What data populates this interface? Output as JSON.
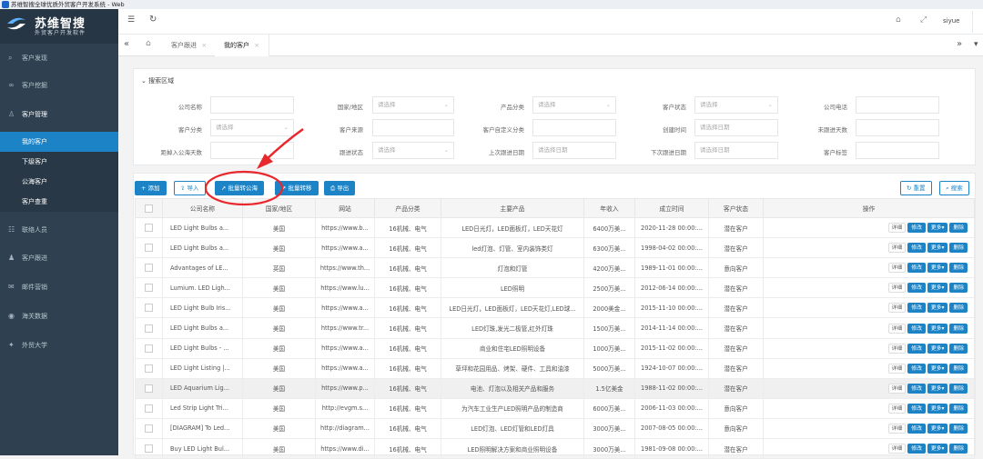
{
  "window": {
    "title": "苏维智搜全球优质外贸客户开发系统 - Web"
  },
  "logo": {
    "name": "苏维智搜",
    "slogan": "外贸客户开发软件"
  },
  "sidebar": {
    "items": [
      {
        "label": "客户发现",
        "icon": "search-icon"
      },
      {
        "label": "客户挖掘",
        "icon": "link-icon"
      },
      {
        "label": "客户管理",
        "icon": "user-icon"
      },
      {
        "label": "联络人员",
        "icon": "contacts-icon"
      },
      {
        "label": "客户跟进",
        "icon": "followup-icon"
      },
      {
        "label": "邮件营销",
        "icon": "mail-icon"
      },
      {
        "label": "海关数据",
        "icon": "globe-icon"
      },
      {
        "label": "外贸大学",
        "icon": "graduation-icon"
      }
    ],
    "subitems": [
      {
        "label": "我的客户",
        "active": true
      },
      {
        "label": "下级客户",
        "active": false
      },
      {
        "label": "公海客户",
        "active": false
      },
      {
        "label": "客户查重",
        "active": false
      }
    ]
  },
  "topbar": {
    "user": "siyue"
  },
  "tabs": [
    {
      "label": "客户跟进",
      "active": false
    },
    {
      "label": "我的客户",
      "active": true
    }
  ],
  "search": {
    "title": "搜索区域",
    "fields": [
      {
        "label": "公司名称",
        "value": "",
        "placeholder": ""
      },
      {
        "label": "国家/地区",
        "value": "",
        "placeholder": "请选择"
      },
      {
        "label": "产品分类",
        "value": "",
        "placeholder": "请选择"
      },
      {
        "label": "客户状态",
        "value": "",
        "placeholder": "请选择"
      },
      {
        "label": "公司电话",
        "value": "",
        "placeholder": ""
      },
      {
        "label": "客户分类",
        "value": "",
        "placeholder": "请选择"
      },
      {
        "label": "客户来源",
        "value": "",
        "placeholder": ""
      },
      {
        "label": "客户自定义分类",
        "value": "",
        "placeholder": ""
      },
      {
        "label": "创建时间",
        "value": "",
        "placeholder": "请选择日期"
      },
      {
        "label": "未跟进天数",
        "value": "",
        "placeholder": ""
      },
      {
        "label": "距掉入公海天数",
        "value": "",
        "placeholder": ""
      },
      {
        "label": "跟进状态",
        "value": "",
        "placeholder": "请选择"
      },
      {
        "label": "上次跟进日期",
        "value": "",
        "placeholder": "请选择日期"
      },
      {
        "label": "下次跟进日期",
        "value": "",
        "placeholder": "请选择日期"
      },
      {
        "label": "客户标签",
        "value": "",
        "placeholder": ""
      }
    ]
  },
  "toolbar": {
    "add": "+ 添加",
    "import": "导入",
    "batch_to_pool": "批量转公海",
    "batch_transfer": "批量转移",
    "export": "导出",
    "reset": "重置",
    "search": "搜索"
  },
  "table": {
    "columns": [
      "公司名称",
      "国家/地区",
      "网站",
      "产品分类",
      "主要产品",
      "年收入",
      "成立时间",
      "客户状态",
      "操作"
    ],
    "actions": {
      "detail": "详细",
      "edit": "修改",
      "more": "更多▾",
      "delete": "删除"
    },
    "rows": [
      [
        "LED Light Bulbs a...",
        "美国",
        "https://www.b...",
        "16机械、电气",
        "LED日光灯，LED面板灯，LED天花灯",
        "6400万美...",
        "2020-11-28 00:00:...",
        "潜在客户"
      ],
      [
        "LED Light Bulbs a...",
        "美国",
        "https://www.a...",
        "16机械、电气",
        "led灯泡、灯管、室内装饰类灯",
        "6300万美...",
        "1998-04-02 00:00:...",
        "潜在客户"
      ],
      [
        "Advantages of LE...",
        "英国",
        "https://www.th...",
        "16机械、电气",
        "灯泡和灯管",
        "4200万美...",
        "1989-11-01 00:00:...",
        "意向客户"
      ],
      [
        "Lumium. LED Ligh...",
        "美国",
        "https://www.lu...",
        "16机械、电气",
        "LED照明",
        "2500万美...",
        "2012-06-14 00:00:...",
        "潜在客户"
      ],
      [
        "LED Light Bulb Iris...",
        "美国",
        "https://www.a...",
        "16机械、电气",
        "LED日光灯，LED面板灯，LED天花灯,LED球...",
        "2000美金...",
        "2015-11-10 00:00:...",
        "潜在客户"
      ],
      [
        "LED Light Bulbs a...",
        "美国",
        "https://www.tr...",
        "16机械、电气",
        "LED灯珠,发光二极管,红外灯珠",
        "1500万美...",
        "2014-11-14 00:00:...",
        "潜在客户"
      ],
      [
        "LED Light Bulbs - ...",
        "美国",
        "https://www.a...",
        "16机械、电气",
        "商业和住宅LED照明设备",
        "1000万美...",
        "2015-11-02 00:00:...",
        "潜在客户"
      ],
      [
        "LED Light Listing |...",
        "美国",
        "https://www.a...",
        "16机械、电气",
        "草坪和花园用品、烤架、硬件、工具和油漆",
        "5000万美...",
        "1924-10-07 00:00:...",
        "潜在客户"
      ],
      [
        "LED Aquarium Lig...",
        "美国",
        "https://www.p...",
        "16机械、电气",
        "电池、灯泡以及相关产品和服务",
        "1.5亿美金",
        "1988-11-02 00:00:...",
        "潜在客户"
      ],
      [
        "Led Strip Light Tri...",
        "美国",
        "http://evgm.s...",
        "16机械、电气",
        "为汽车工业生产LED照明产品的制造商",
        "6000万美...",
        "2006-11-03 00:00:...",
        "意向客户"
      ],
      [
        "[DIAGRAM] To Led...",
        "美国",
        "http://diagram...",
        "16机械、电气",
        "LED灯泡、LED灯管和LED灯具",
        "3000万美...",
        "2007-08-05 00:00:...",
        "意向客户"
      ],
      [
        "Buy LED Light Bul...",
        "美国",
        "https://www.di...",
        "16机械、电气",
        "LED照明解决方案和商业照明设备",
        "3000万美...",
        "1981-09-08 00:00:...",
        "潜在客户"
      ]
    ]
  },
  "colors": {
    "sidebar": "#2f4050",
    "accent": "#1c84c6",
    "annotation": "#e8282c"
  }
}
